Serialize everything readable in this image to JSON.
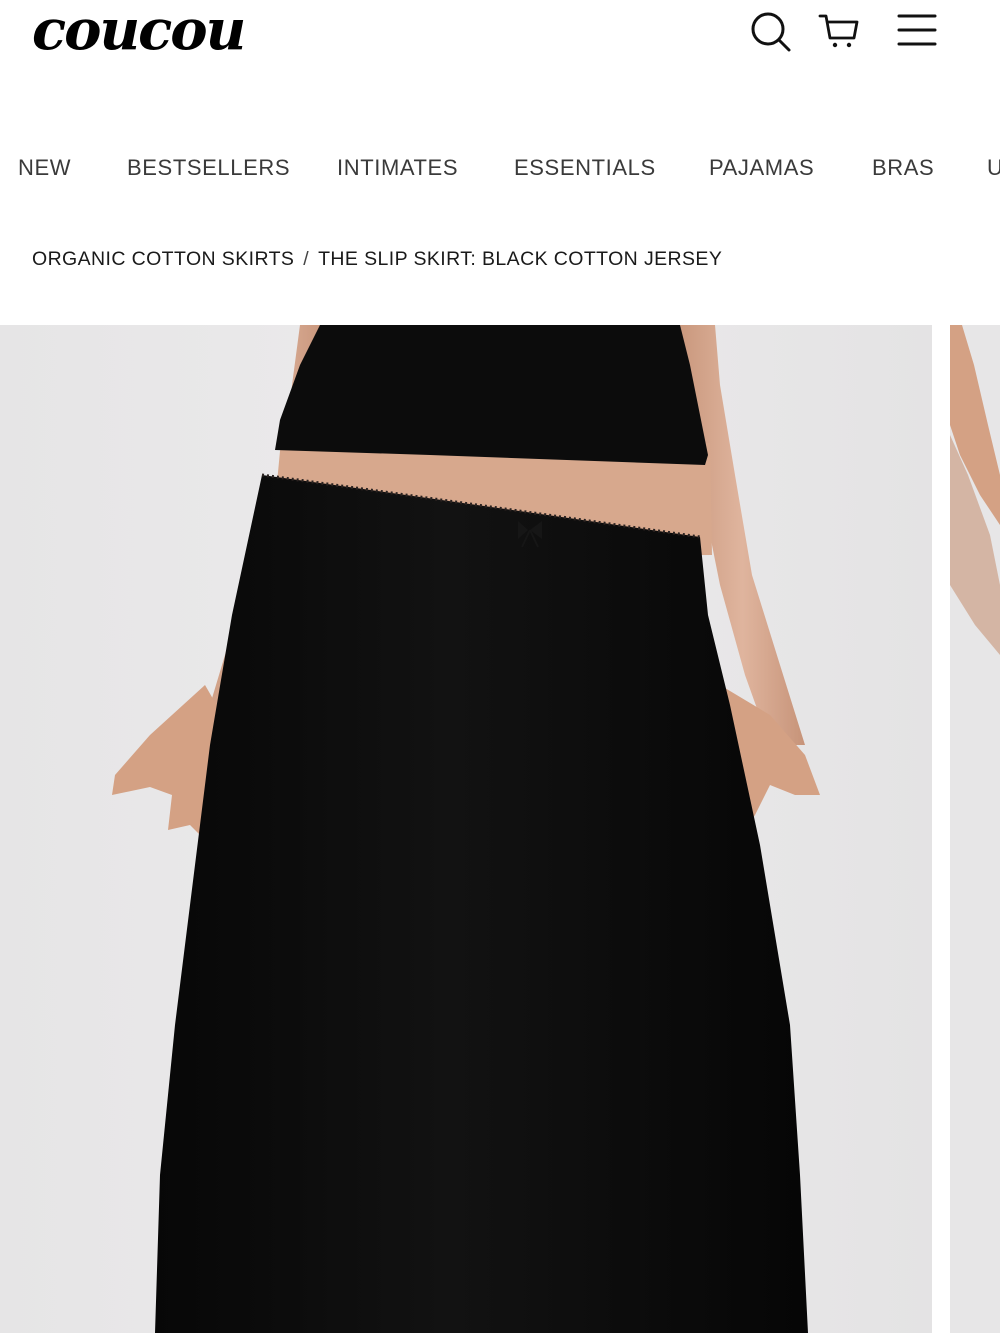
{
  "brand": {
    "logo_text": "coucou"
  },
  "header": {
    "icons": [
      {
        "name": "search-icon"
      },
      {
        "name": "cart-icon"
      },
      {
        "name": "menu-icon"
      }
    ]
  },
  "nav": {
    "items": [
      {
        "label": "NEW"
      },
      {
        "label": "BESTSELLERS"
      },
      {
        "label": "INTIMATES"
      },
      {
        "label": "ESSENTIALS"
      },
      {
        "label": "PAJAMAS"
      },
      {
        "label": "BRAS"
      },
      {
        "label": "U"
      }
    ]
  },
  "breadcrumb": {
    "parent": "ORGANIC COTTON SKIRTS",
    "separator": "/",
    "current": "THE SLIP SKIRT: BLACK COTTON JERSEY"
  },
  "colors": {
    "text": "#1a1a1a",
    "nav_text": "#3a3a3a",
    "photo_background": "#e9e8e9",
    "garment": "#0d0d0d",
    "skin": "#d8a98e"
  }
}
